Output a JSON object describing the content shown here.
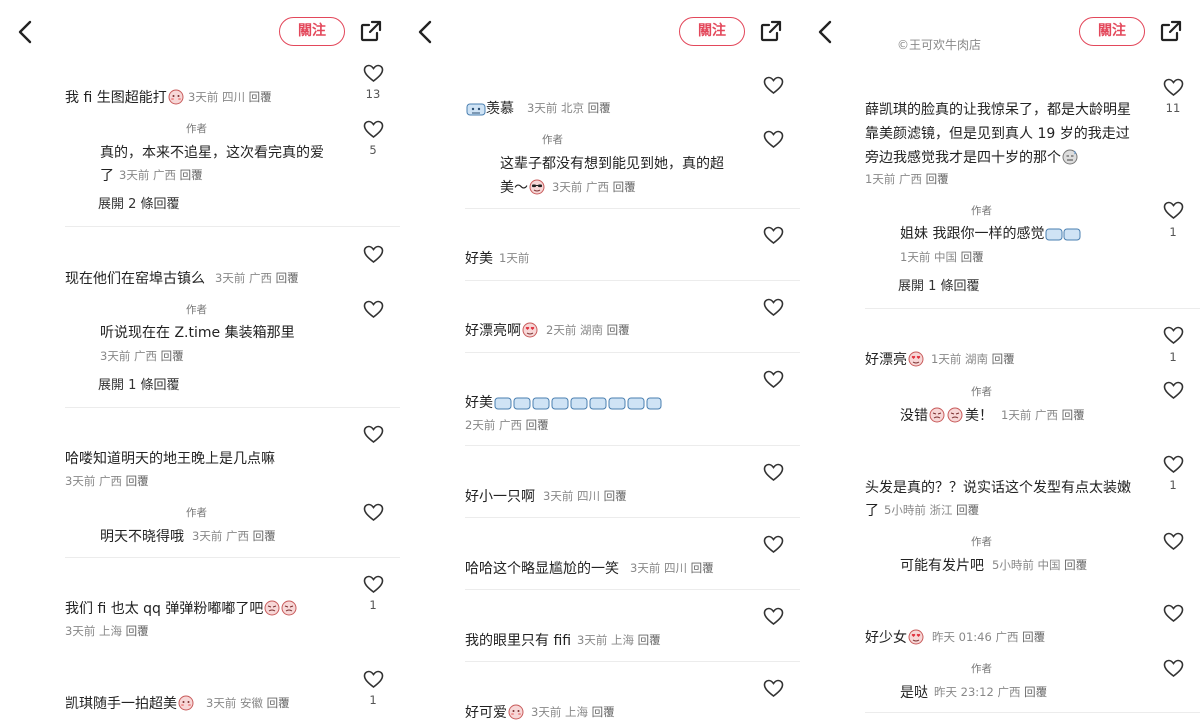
{
  "ui": {
    "follow_label": "關注",
    "author_tag": "作者",
    "reply_label": "回覆",
    "shop_badge": "©王可欢牛肉店"
  },
  "icons": {
    "back": "chevron-left-icon",
    "share": "share-icon",
    "like": "heart-icon",
    "emoji_blush": "blush-emoji-icon",
    "emoji_envy": "envy-emoji-icon",
    "emoji_heart_eyes": "heart-eyes-emoji-icon",
    "emoji_cool": "cool-emoji-icon",
    "emoji_sweat": "sweat-emoji-icon"
  },
  "colors": {
    "accent": "#e3485b",
    "meta": "#888888",
    "divider": "#ececec"
  },
  "panel1": {
    "c1": {
      "text": "我 fi 生图超能打",
      "time": "3天前",
      "loc": "四川",
      "likes": "13"
    },
    "c1r": {
      "line1": "真的，本来不追星，这次看完真的爱",
      "line2": "了",
      "time": "3天前",
      "loc": "广西",
      "likes": "5"
    },
    "c1x": "展開 2 條回覆",
    "c2": {
      "text": "现在他们在窑埠古镇么",
      "time": "3天前",
      "loc": "广西"
    },
    "c2r": {
      "text": "听说现在在 Z.time 集装箱那里",
      "time": "3天前",
      "loc": "广西"
    },
    "c2x": "展開 1 條回覆",
    "c3": {
      "text": "哈喽知道明天的地王晚上是几点嘛",
      "time": "3天前",
      "loc": "广西"
    },
    "c3r": {
      "text": "明天不晓得哦",
      "time": "3天前",
      "loc": "广西"
    },
    "c4": {
      "text": "我们 fi 也太 qq 弹弹粉嘟嘟了吧",
      "time": "3天前",
      "loc": "上海",
      "likes": "1"
    },
    "c5": {
      "text": "凯琪随手一拍超美",
      "time": "3天前",
      "loc": "安徽",
      "likes": "1"
    }
  },
  "panel2": {
    "c1": {
      "text": "羡慕",
      "time": "3天前",
      "loc": "北京"
    },
    "c1r": {
      "line1": "这辈子都没有想到能见到她，真的超",
      "line2": "美～",
      "time": "3天前",
      "loc": "广西"
    },
    "c2": {
      "text": "好美",
      "time": "1天前"
    },
    "c3": {
      "text": "好漂亮啊",
      "time": "2天前",
      "loc": "湖南"
    },
    "c4": {
      "text": "好美",
      "time": "2天前",
      "loc": "广西"
    },
    "c5": {
      "text": "好小一只啊",
      "time": "3天前",
      "loc": "四川"
    },
    "c6": {
      "text": "哈哈这个略显尴尬的一笑",
      "time": "3天前",
      "loc": "四川"
    },
    "c7": {
      "text": "我的眼里只有 fifi",
      "time": "3天前",
      "loc": "上海"
    },
    "c8": {
      "text": "好可爱",
      "time": "3天前",
      "loc": "上海"
    }
  },
  "panel3": {
    "c1": {
      "line1": "薛凯琪的脸真的让我惊呆了，都是大龄明星",
      "line2": "靠美颜滤镜，但是见到真人 19 岁的我走过",
      "line3": "旁边我感觉我才是四十岁的那个",
      "time": "1天前",
      "loc": "广西",
      "likes": "11"
    },
    "c1r": {
      "text": "姐妹 我跟你一样的感觉",
      "time": "1天前",
      "loc": "中国",
      "likes": "1"
    },
    "c1x": "展開 1 條回覆",
    "c2": {
      "text": "好漂亮",
      "time": "1天前",
      "loc": "湖南",
      "likes": "1"
    },
    "c2r": {
      "text": "没错",
      "text2": "美！",
      "time": "1天前",
      "loc": "广西"
    },
    "c3": {
      "line1": "头发是真的？？说实话这个发型有点太装嫩",
      "line2": "了",
      "time": "5小時前",
      "loc": "浙江",
      "likes": "1"
    },
    "c3r": {
      "text": "可能有发片吧",
      "time": "5小時前",
      "loc": "中国"
    },
    "c4": {
      "text": "好少女",
      "time": "昨天 01:46",
      "loc": "广西"
    },
    "c4r": {
      "text": "是哒",
      "time": "昨天 23:12",
      "loc": "广西"
    }
  }
}
